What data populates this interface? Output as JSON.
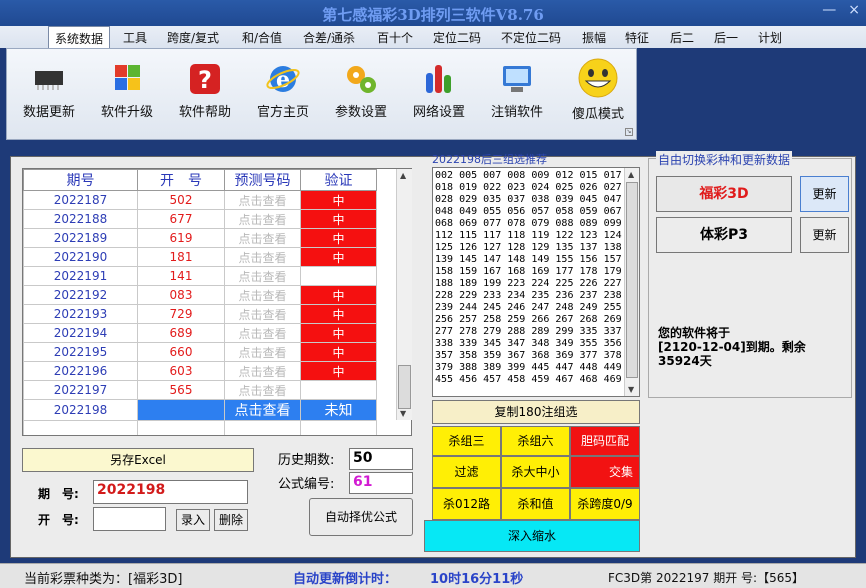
{
  "title": "第七感福彩3D排列三软件V8.76",
  "window_controls": [
    "—",
    "×"
  ],
  "menu": [
    "系统数据",
    "工具",
    "跨度/复式",
    "和/合值",
    "合差/通杀",
    "百十个",
    "定位二码",
    "不定位二码",
    "振幅",
    "特征",
    "后二",
    "后一",
    "计划"
  ],
  "ribbon": [
    {
      "label": "数据更新",
      "icon": "chip-icon"
    },
    {
      "label": "软件升级",
      "icon": "windows-icon"
    },
    {
      "label": "软件帮助",
      "icon": "help-icon"
    },
    {
      "label": "官方主页",
      "icon": "ie-icon"
    },
    {
      "label": "参数设置",
      "icon": "gears-icon"
    },
    {
      "label": "网络设置",
      "icon": "bars-icon"
    },
    {
      "label": "注销软件",
      "icon": "monitor-icon"
    },
    {
      "label": "傻瓜模式",
      "icon": "smiley-icon"
    }
  ],
  "grid": {
    "headers": [
      "期号",
      "开　号",
      "预测号码",
      "验证"
    ],
    "rows": [
      {
        "period": "2022187",
        "open": "502",
        "predict": "点击查看",
        "verify": "中",
        "state": "hit"
      },
      {
        "period": "2022188",
        "open": "677",
        "predict": "点击查看",
        "verify": "中",
        "state": "hit"
      },
      {
        "period": "2022189",
        "open": "619",
        "predict": "点击查看",
        "verify": "中",
        "state": "hit"
      },
      {
        "period": "2022190",
        "open": "181",
        "predict": "点击查看",
        "verify": "中",
        "state": "hit"
      },
      {
        "period": "2022191",
        "open": "141",
        "predict": "点击查看",
        "verify": "",
        "state": "none"
      },
      {
        "period": "2022192",
        "open": "083",
        "predict": "点击查看",
        "verify": "中",
        "state": "hit"
      },
      {
        "period": "2022193",
        "open": "729",
        "predict": "点击查看",
        "verify": "中",
        "state": "hit"
      },
      {
        "period": "2022194",
        "open": "689",
        "predict": "点击查看",
        "verify": "中",
        "state": "hit"
      },
      {
        "period": "2022195",
        "open": "660",
        "predict": "点击查看",
        "verify": "中",
        "state": "hit"
      },
      {
        "period": "2022196",
        "open": "603",
        "predict": "点击查看",
        "verify": "中",
        "state": "hit"
      },
      {
        "period": "2022197",
        "open": "565",
        "predict": "点击查看",
        "verify": "",
        "state": "none"
      },
      {
        "period": "2022198",
        "open": "",
        "predict": "点击查看",
        "verify": "未知",
        "state": "current"
      }
    ]
  },
  "save_excel": "另存Excel",
  "form": {
    "period_label": "期　号:",
    "period_value": "2022198",
    "open_label": "开　号:",
    "open_value": "",
    "input_btn": "录入",
    "delete_btn": "删除",
    "history_label": "历史期数:",
    "history_value": "50",
    "formula_label": "公式编号:",
    "formula_value": "61",
    "auto_btn": "自动择优公式"
  },
  "reco": {
    "title": "2022198后三组选推荐",
    "lines": [
      "002 005 007 008 009 012 015 017",
      "018 019 022 023 024 025 026 027",
      "028 029 035 037 038 039 045 047",
      "048 049 055 056 057 058 059 067",
      "068 069 077 078 079 088 089 099",
      "112 115 117 118 119 122 123 124",
      "125 126 127 128 129 135 137 138",
      "139 145 147 148 149 155 156 157",
      "158 159 167 168 169 177 178 179",
      "188 189 199 223 224 225 226 227",
      "228 229 233 234 235 236 237 238",
      "239 244 245 246 247 248 249 255",
      "256 257 258 259 266 267 268 269",
      "277 278 279 288 289 299 335 337",
      "338 339 345 347 348 349 355 356",
      "357 358 359 367 368 369 377 378",
      "379 388 389 399 445 447 448 449",
      "455 456 457 458 459 467 468 469"
    ],
    "copy_btn": "复制180注组选",
    "buttons": [
      {
        "label": "杀组三",
        "style": "yel"
      },
      {
        "label": "杀组六",
        "style": "yel"
      },
      {
        "label": "胆码匹配",
        "style": "redb"
      },
      {
        "label": "过滤",
        "style": "yel"
      },
      {
        "label": "杀大中小",
        "style": "yel"
      },
      {
        "label": "交集",
        "style": "redb"
      },
      {
        "label": "杀012路",
        "style": "yel"
      },
      {
        "label": "杀和值",
        "style": "yel"
      },
      {
        "label": "杀跨度0/9",
        "style": "yel"
      }
    ],
    "shrink_btn": "深入缩水"
  },
  "switch": {
    "title": "自由切换彩种和更新数据",
    "fc3d": "福彩3D",
    "p3": "体彩P3",
    "update": "更新",
    "expire_line1": "您的软件将于",
    "expire_line2": "[2120-12-04]到期。剩余",
    "expire_line3": "35924天"
  },
  "status": {
    "type_text": "当前彩票种类为：[福彩3D]",
    "countdown_label": "自动更新倒计时：",
    "countdown_value": "10时16分11秒",
    "last_draw": "FC3D第 2022197 期开  号:【565】"
  },
  "colors": {
    "hit": "#f51010",
    "current": "#2d7ff0",
    "yellow": "#ffef05",
    "cyan": "#06e8f5"
  }
}
